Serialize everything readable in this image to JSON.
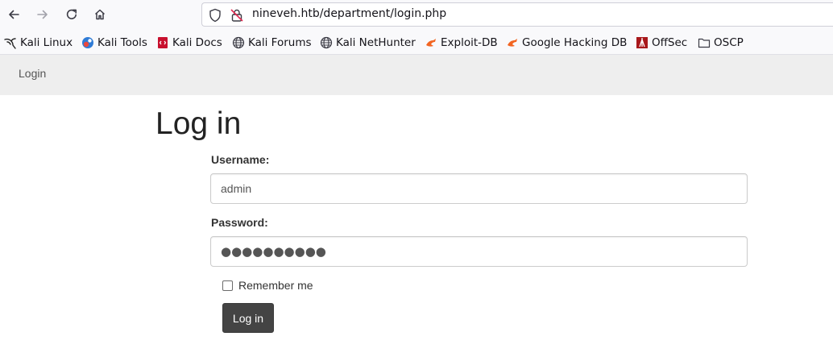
{
  "browser": {
    "url": "nineveh.htb/department/login.php",
    "bookmarks": [
      {
        "label": "Kali Linux",
        "icon": "kali-dragon-icon"
      },
      {
        "label": "Kali Tools",
        "icon": "kali-tools-icon"
      },
      {
        "label": "Kali Docs",
        "icon": "kali-docs-icon"
      },
      {
        "label": "Kali Forums",
        "icon": "globe-icon"
      },
      {
        "label": "Kali NetHunter",
        "icon": "globe-icon"
      },
      {
        "label": "Exploit-DB",
        "icon": "exploit-db-icon"
      },
      {
        "label": "Google Hacking DB",
        "icon": "exploit-db-icon"
      },
      {
        "label": "OffSec",
        "icon": "offsec-icon"
      },
      {
        "label": "OSCP",
        "icon": "folder-icon"
      }
    ]
  },
  "navbar": {
    "brand_link": "Login"
  },
  "form": {
    "title": "Log in",
    "username_label": "Username:",
    "username_value": "admin",
    "password_label": "Password:",
    "password_value": "●●●●●●●●●●",
    "remember_label": "Remember me",
    "remember_checked": false,
    "submit_label": "Log in"
  },
  "colors": {
    "navbar_bg": "#eeeeee",
    "button_bg": "#444444",
    "toolbar_bg": "#f9f9fb"
  }
}
